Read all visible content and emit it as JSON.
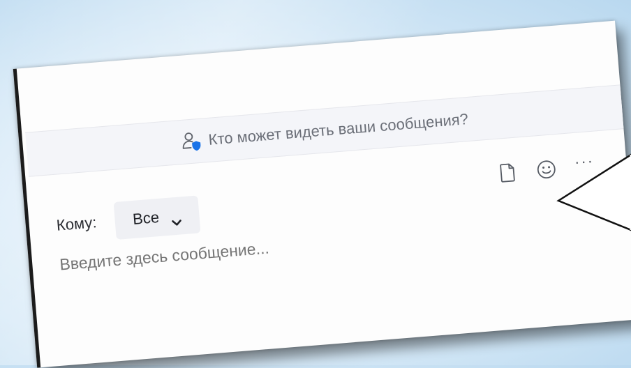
{
  "notice": {
    "text": "Кто может видеть ваши сообщения?",
    "icon": "user-shield-icon",
    "icon_accent": "#1a73e8"
  },
  "compose": {
    "to_label": "Кому:",
    "recipient_value": "Все",
    "message_placeholder": "Введите здесь сообщение..."
  },
  "toolbar": {
    "icons": [
      "file-icon",
      "emoji-icon",
      "more-icon"
    ],
    "more_glyph": "···"
  },
  "colors": {
    "card_border": "#1b1b1b",
    "notice_bg": "#f4f5f9",
    "select_bg": "#eff0f4",
    "text_muted": "#8e929a"
  }
}
